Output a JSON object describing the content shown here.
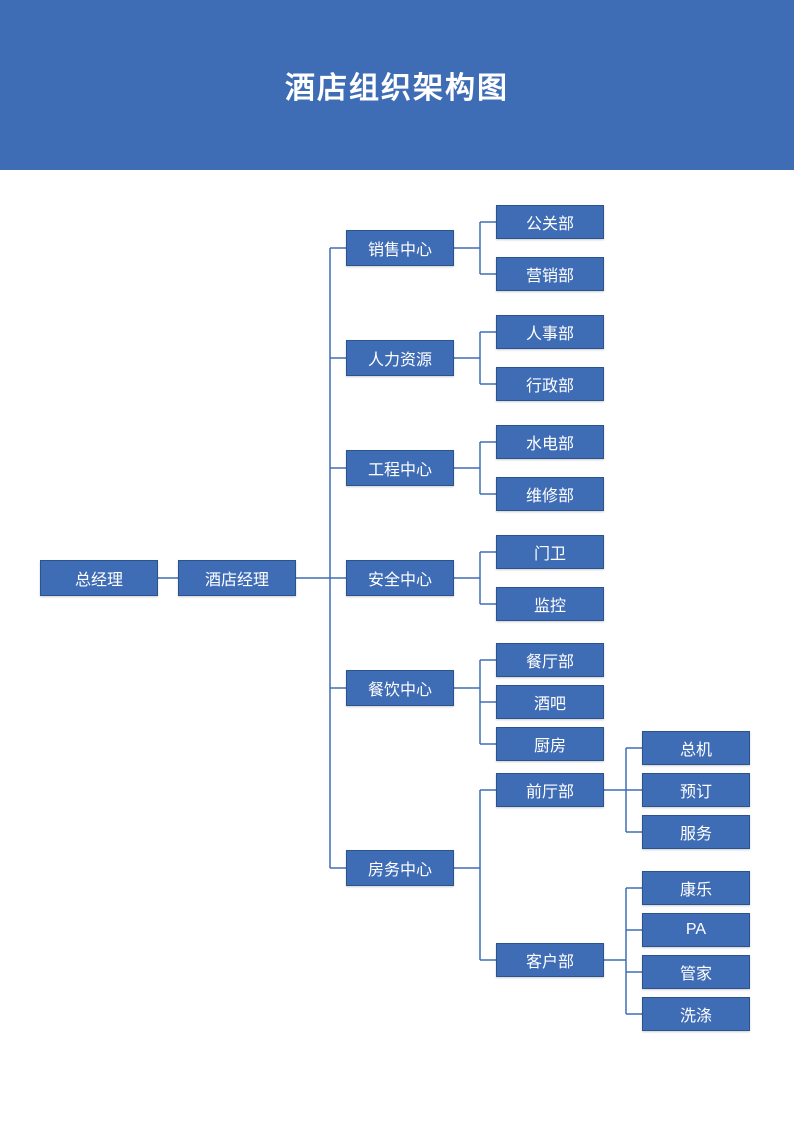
{
  "title": "酒店组织架构图",
  "colors": {
    "primary": "#3f6db5",
    "border": "#2b548f",
    "text": "#ffffff"
  },
  "chart_data": {
    "type": "tree",
    "title": "酒店组织架构图",
    "root": {
      "name": "总经理",
      "children": [
        {
          "name": "酒店经理",
          "children": [
            {
              "name": "销售中心",
              "children": [
                {
                  "name": "公关部"
                },
                {
                  "name": "营销部"
                }
              ]
            },
            {
              "name": "人力资源",
              "children": [
                {
                  "name": "人事部"
                },
                {
                  "name": "行政部"
                }
              ]
            },
            {
              "name": "工程中心",
              "children": [
                {
                  "name": "水电部"
                },
                {
                  "name": "维修部"
                }
              ]
            },
            {
              "name": "安全中心",
              "children": [
                {
                  "name": "门卫"
                },
                {
                  "name": "监控"
                }
              ]
            },
            {
              "name": "餐饮中心",
              "children": [
                {
                  "name": "餐厅部"
                },
                {
                  "name": "酒吧"
                },
                {
                  "name": "厨房"
                }
              ]
            },
            {
              "name": "房务中心",
              "children": [
                {
                  "name": "前厅部",
                  "children": [
                    {
                      "name": "总机"
                    },
                    {
                      "name": "预订"
                    },
                    {
                      "name": "服务"
                    }
                  ]
                },
                {
                  "name": "客户部",
                  "children": [
                    {
                      "name": "康乐"
                    },
                    {
                      "name": "PA"
                    },
                    {
                      "name": "管家"
                    },
                    {
                      "name": "洗涤"
                    }
                  ]
                }
              ]
            }
          ]
        }
      ]
    }
  },
  "nodes": {
    "gm": "总经理",
    "hm": "酒店经理",
    "sales": "销售中心",
    "hr": "人力资源",
    "eng": "工程中心",
    "safe": "安全中心",
    "fb": "餐饮中心",
    "rooms": "房务中心",
    "pr": "公关部",
    "mkt": "营销部",
    "pers": "人事部",
    "admin": "行政部",
    "util": "水电部",
    "maint": "维修部",
    "guard": "门卫",
    "cctv": "监控",
    "rest": "餐厅部",
    "bar": "酒吧",
    "kitchen": "厨房",
    "front": "前厅部",
    "cust": "客户部",
    "switch": "总机",
    "resv": "预订",
    "serv": "服务",
    "recr": "康乐",
    "pa": "PA",
    "butler": "管家",
    "laundry": "洗涤"
  }
}
